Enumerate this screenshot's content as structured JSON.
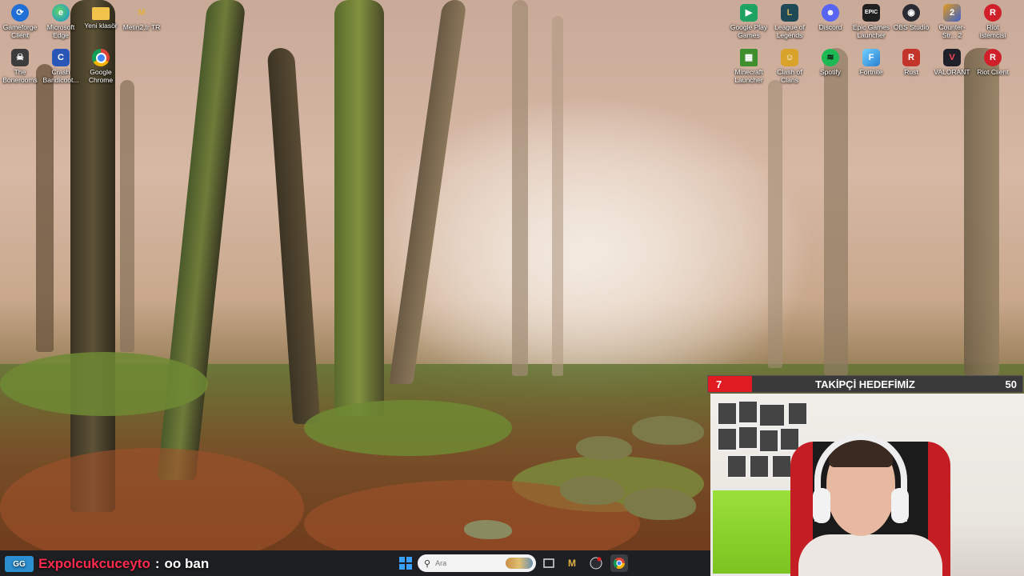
{
  "desktop": {
    "left_icons": [
      {
        "label": "Gameforge Client",
        "icon": "gameforge-icon",
        "color": "#1f6fd6"
      },
      {
        "label": "Microsoft Edge",
        "icon": "edge-icon",
        "color": "#2aa3d8"
      },
      {
        "label": "Yeni klasör",
        "icon": "folder-icon",
        "color": "#f2c34a"
      },
      {
        "label": "Metin2.tr TR",
        "icon": "metin2-icon",
        "color": "#b8862a"
      },
      {
        "label": "The Bonerooms",
        "icon": "bonerooms-icon",
        "color": "#3c3c3c"
      },
      {
        "label": "Crash Bandicoot...",
        "icon": "crash-icon",
        "color": "#2a56b8"
      },
      {
        "label": "Google Chrome",
        "icon": "chrome-icon",
        "color": "#db4437"
      }
    ],
    "right_icons": [
      {
        "label": "Google Play Games",
        "icon": "google-play-games-icon",
        "color": "#1ea362"
      },
      {
        "label": "League of Legends",
        "icon": "league-of-legends-icon",
        "color": "#1f4a55"
      },
      {
        "label": "Discord",
        "icon": "discord-icon",
        "color": "#5865f2"
      },
      {
        "label": "Epic Games Launcher",
        "icon": "epic-games-icon",
        "color": "#202020"
      },
      {
        "label": "OBS Studio",
        "icon": "obs-icon",
        "color": "#2b2b33"
      },
      {
        "label": "Counter-Str... 2",
        "icon": "counter-strike-icon",
        "color": "#e39a1e"
      },
      {
        "label": "Riot istemcisi",
        "icon": "riot-icon",
        "color": "#d0202a"
      },
      {
        "label": "Minecraft Launcher",
        "icon": "minecraft-icon",
        "color": "#3f8f2e"
      },
      {
        "label": "Clash of Clans",
        "icon": "clash-of-clans-icon",
        "color": "#d9a22a"
      },
      {
        "label": "Spotify",
        "icon": "spotify-icon",
        "color": "#1db954"
      },
      {
        "label": "Fortnite",
        "icon": "fortnite-icon",
        "color": "#4fb3e8"
      },
      {
        "label": "Rust",
        "icon": "rust-icon",
        "color": "#c3342a"
      },
      {
        "label": "VALORANT",
        "icon": "valorant-icon",
        "color": "#20202a"
      },
      {
        "label": "Riot Client",
        "icon": "riot-client-icon",
        "color": "#d0202a"
      }
    ]
  },
  "chat": {
    "badge": "GG",
    "username": "Expolcukcuceyto",
    "separator": ":",
    "message": "oo ban"
  },
  "goal": {
    "current": "7",
    "title": "TAKİPÇİ HEDEFİMİZ",
    "target": "50",
    "progress_fraction": 0.14
  },
  "taskbar": {
    "search_placeholder": "Ara",
    "apps": [
      "windows-start-icon",
      "task-view-icon",
      "metin2-taskbar-icon",
      "obs-taskbar-icon",
      "chrome-taskbar-icon"
    ]
  }
}
